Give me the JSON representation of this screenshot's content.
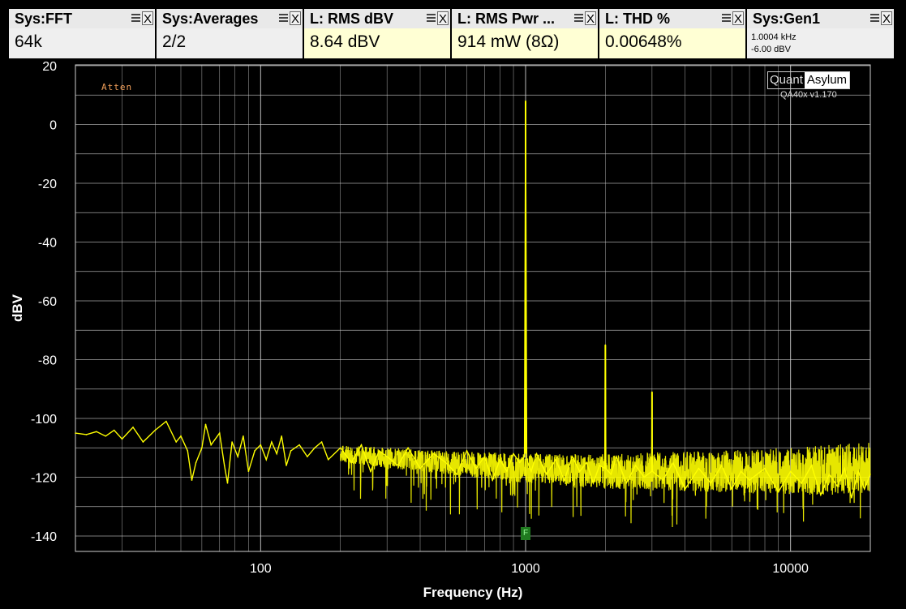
{
  "tiles": [
    {
      "title": "Sys:FFT",
      "value": "64k",
      "highlight": false
    },
    {
      "title": "Sys:Averages",
      "value": "2/2",
      "highlight": false
    },
    {
      "title": "L: RMS dBV",
      "value": "8.64 dBV",
      "highlight": true
    },
    {
      "title": "L: RMS Pwr ...",
      "value": "914 mW (8Ω)",
      "highlight": true
    },
    {
      "title": "L: THD %",
      "value": "0.00648%",
      "highlight": true
    },
    {
      "title": "Sys:Gen1",
      "line1": "1.0004 kHz",
      "line2": "-6.00 dBV",
      "highlight": false
    }
  ],
  "tile_close_glyph": "X",
  "brand": {
    "part1": "Quant",
    "part2": "Asylum",
    "version": "QA40x v1.170"
  },
  "annotation": "Atten",
  "marker_label": "F",
  "colors": {
    "trace": "#ffff00",
    "grid": "#cfcfcf",
    "background": "#000000",
    "axis_text": "#ffffff",
    "marker": "#1f7a1f"
  },
  "chart_data": {
    "type": "line",
    "title": "",
    "xlabel": "Frequency (Hz)",
    "ylabel": "dBV",
    "xscale": "log",
    "xlim": [
      20,
      20000
    ],
    "ylim": [
      -145,
      20
    ],
    "xticks": [
      100,
      1000,
      10000
    ],
    "yticks": [
      20,
      0,
      -20,
      -40,
      -60,
      -80,
      -100,
      -120,
      -140
    ],
    "grid": true,
    "series": [
      {
        "points": [
          [
            20,
            -105
          ],
          [
            22,
            -105.5
          ],
          [
            24,
            -104.5
          ],
          [
            26,
            -106
          ],
          [
            28,
            -104
          ],
          [
            30,
            -107
          ],
          [
            33,
            -103
          ],
          [
            36,
            -108
          ],
          [
            40,
            -104
          ],
          [
            44,
            -101
          ],
          [
            48,
            -108
          ],
          [
            50,
            -106
          ],
          [
            53,
            -111
          ],
          [
            55,
            -121
          ],
          [
            57,
            -115
          ],
          [
            60,
            -110
          ],
          [
            62,
            -102
          ],
          [
            65,
            -109
          ],
          [
            70,
            -105
          ],
          [
            73,
            -116
          ],
          [
            75,
            -122
          ],
          [
            78,
            -108
          ],
          [
            82,
            -113
          ],
          [
            86,
            -106
          ],
          [
            90,
            -118
          ],
          [
            95,
            -111
          ],
          [
            100,
            -109
          ],
          [
            105,
            -114
          ],
          [
            110,
            -108
          ],
          [
            115,
            -112
          ],
          [
            120,
            -106
          ],
          [
            125,
            -116
          ],
          [
            130,
            -111
          ],
          [
            140,
            -109
          ],
          [
            150,
            -113
          ],
          [
            160,
            -110
          ],
          [
            170,
            -108
          ],
          [
            180,
            -114
          ],
          [
            200,
            -110
          ],
          [
            220,
            -115
          ],
          [
            240,
            -109
          ],
          [
            260,
            -118
          ],
          [
            280,
            -111
          ],
          [
            300,
            -113
          ],
          [
            330,
            -116
          ],
          [
            360,
            -110
          ],
          [
            400,
            -117
          ],
          [
            450,
            -112
          ],
          [
            500,
            -115
          ],
          [
            550,
            -119
          ],
          [
            600,
            -111
          ],
          [
            650,
            -117
          ],
          [
            700,
            -113
          ],
          [
            750,
            -121
          ],
          [
            800,
            -114
          ],
          [
            850,
            -118
          ],
          [
            900,
            -112
          ],
          [
            950,
            -115
          ],
          [
            990,
            -113
          ],
          [
            1000,
            8
          ],
          [
            1010,
            -114
          ],
          [
            1050,
            -118
          ],
          [
            1100,
            -112
          ],
          [
            1200,
            -119
          ],
          [
            1300,
            -114
          ],
          [
            1400,
            -121
          ],
          [
            1500,
            -113
          ],
          [
            1600,
            -118
          ],
          [
            1700,
            -115
          ],
          [
            1800,
            -122
          ],
          [
            1900,
            -116
          ],
          [
            1990,
            -117
          ],
          [
            2000,
            -75
          ],
          [
            2010,
            -117
          ],
          [
            2100,
            -119
          ],
          [
            2200,
            -113
          ],
          [
            2400,
            -122
          ],
          [
            2600,
            -116
          ],
          [
            2800,
            -120
          ],
          [
            2990,
            -118
          ],
          [
            3000,
            -91
          ],
          [
            3010,
            -118
          ],
          [
            3300,
            -121
          ],
          [
            3600,
            -115
          ],
          [
            4000,
            -124
          ],
          [
            4500,
            -117
          ],
          [
            5000,
            -122
          ],
          [
            5500,
            -116
          ],
          [
            6000,
            -124
          ],
          [
            6500,
            -118
          ],
          [
            7000,
            -121
          ],
          [
            8000,
            -117
          ],
          [
            9000,
            -125
          ],
          [
            10000,
            -118
          ],
          [
            11000,
            -122
          ],
          [
            12000,
            -116
          ],
          [
            13000,
            -126
          ],
          [
            14000,
            -119
          ],
          [
            15000,
            -123
          ],
          [
            16000,
            -117
          ],
          [
            17000,
            -127
          ],
          [
            18000,
            -118
          ],
          [
            19000,
            -124
          ],
          [
            20000,
            -119
          ]
        ],
        "noise_band": [
          [
            200,
            -112,
            3
          ],
          [
            500,
            -115,
            4
          ],
          [
            1000,
            -117,
            5
          ],
          [
            2000,
            -118,
            6
          ],
          [
            5000,
            -118,
            7
          ],
          [
            10000,
            -118,
            8
          ],
          [
            20000,
            -117,
            9
          ]
        ]
      }
    ]
  }
}
